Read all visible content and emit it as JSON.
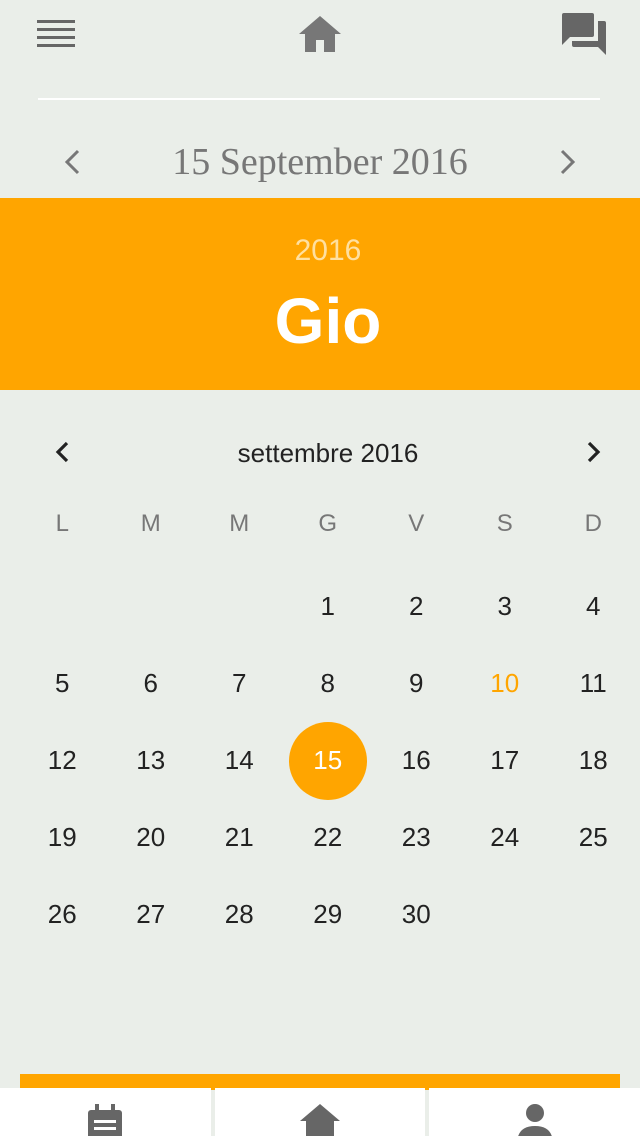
{
  "topbar": {
    "icons": [
      "menu-icon",
      "home-icon",
      "chat-icon"
    ]
  },
  "date_nav": {
    "title": "15 September 2016"
  },
  "picker": {
    "year": "2016",
    "weekday_short": "Gio",
    "month_label": "settembre 2016",
    "weekdays": [
      "L",
      "M",
      "M",
      "G",
      "V",
      "S",
      "D"
    ],
    "weeks": [
      [
        "",
        "",
        "",
        "1",
        "2",
        "3",
        "4"
      ],
      [
        "5",
        "6",
        "7",
        "8",
        "9",
        "10",
        "11"
      ],
      [
        "12",
        "13",
        "14",
        "15",
        "16",
        "17",
        "18"
      ],
      [
        "19",
        "20",
        "21",
        "22",
        "23",
        "24",
        "25"
      ],
      [
        "26",
        "27",
        "28",
        "29",
        "30",
        "",
        ""
      ]
    ],
    "selected_day": "15",
    "today_day": "10",
    "accent_color": "#FFA500"
  },
  "bottom_nav": {
    "icons": [
      "calendar-note-icon",
      "home-icon",
      "person-icon"
    ]
  }
}
